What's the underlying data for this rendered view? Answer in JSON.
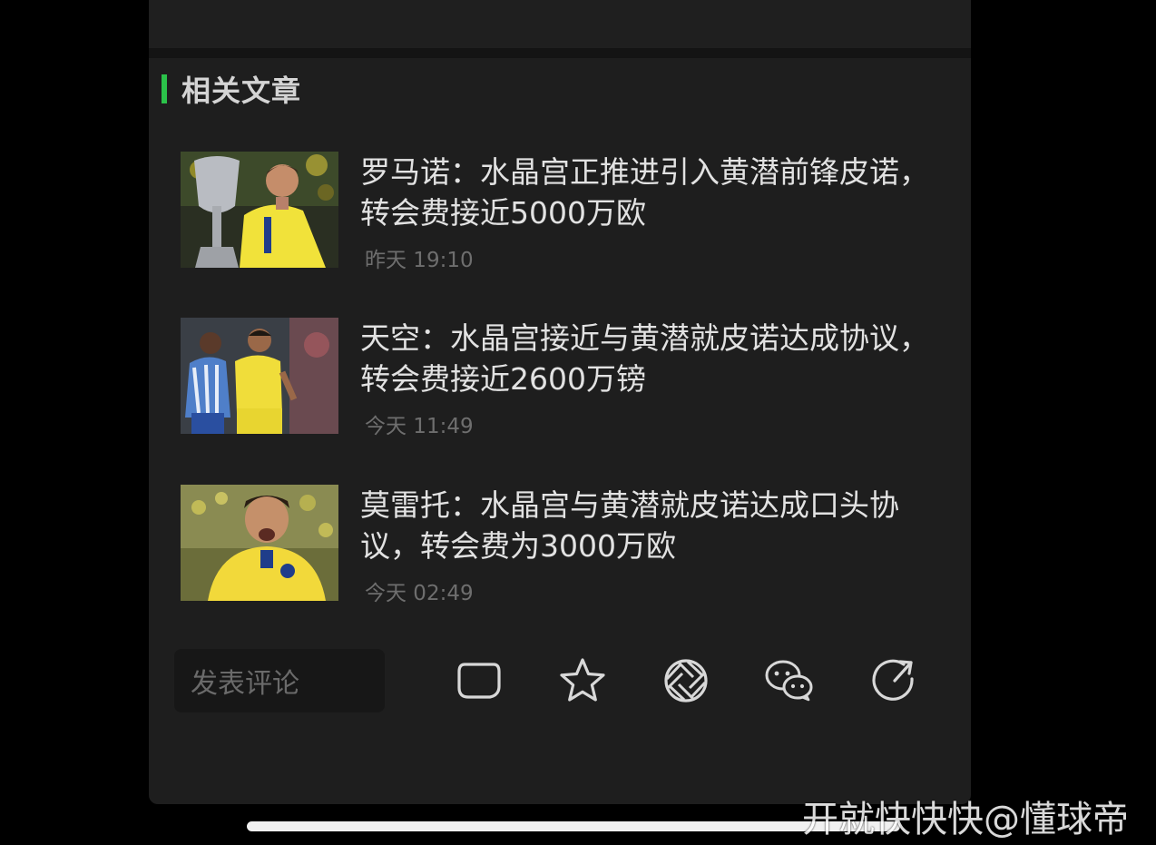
{
  "section": {
    "title": "相关文章",
    "accent_color": "#2bc24a"
  },
  "articles": [
    {
      "title": "罗马诺：水晶宫正推进引入黄潜前锋皮诺，转会费接近5000万欧",
      "time": "昨天 19:10"
    },
    {
      "title": "天空：水晶宫接近与黄潜就皮诺达成协议，转会费接近2600万镑",
      "time": "今天 11:49"
    },
    {
      "title": "莫雷托：水晶宫与黄潜就皮诺达成口头协议，转会费为3000万欧",
      "time": "今天 02:49"
    }
  ],
  "bottom_bar": {
    "comment_placeholder": "发表评论",
    "icons": [
      "comment-icon",
      "star-icon",
      "moments-icon",
      "wechat-icon",
      "share-icon"
    ]
  },
  "watermark": "开就快快快@懂球帝"
}
